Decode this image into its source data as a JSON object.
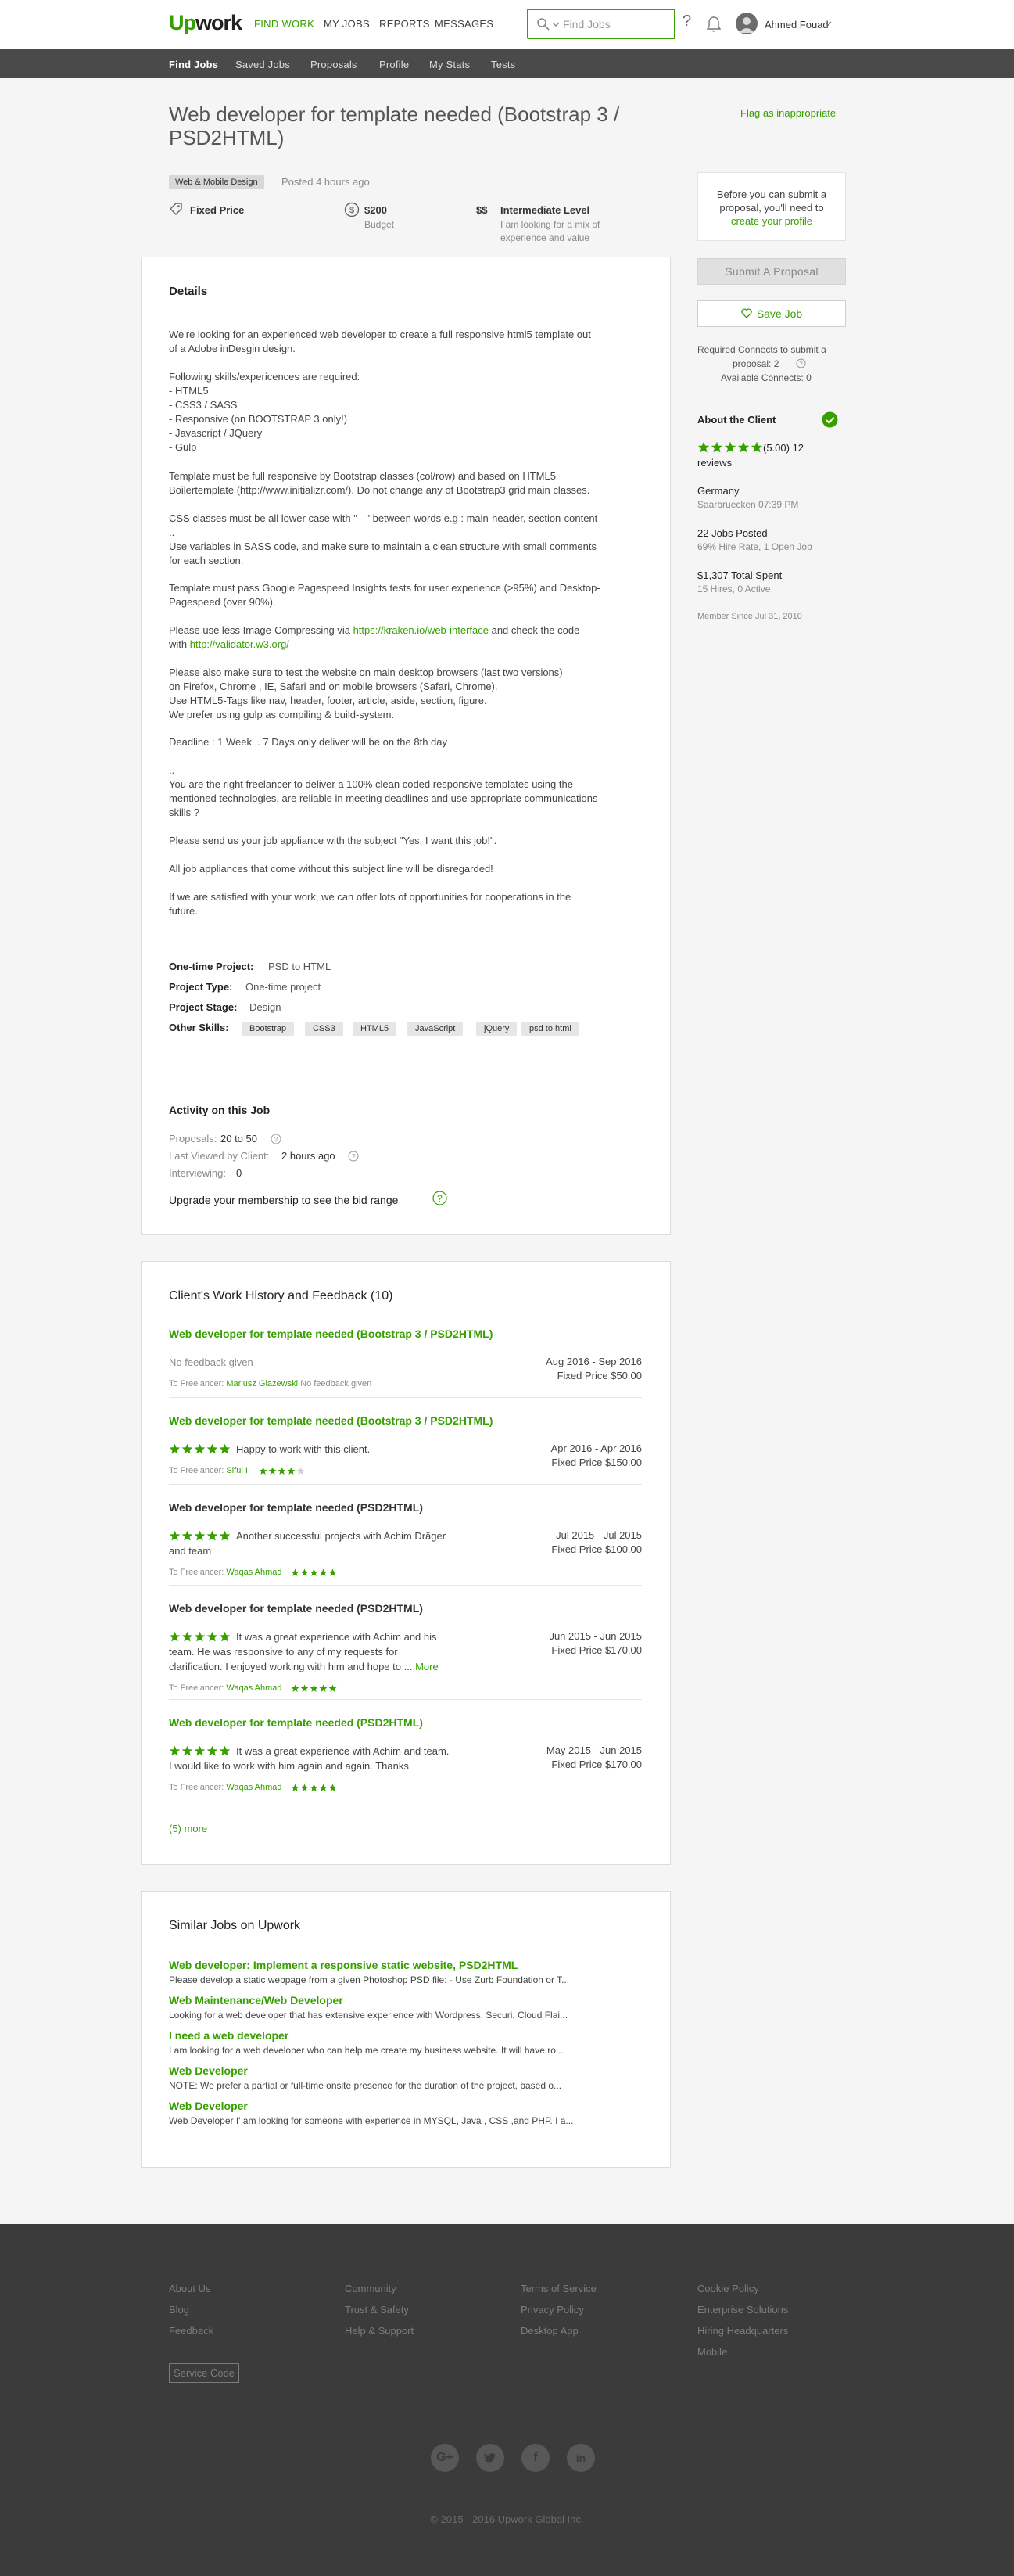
{
  "header": {
    "logo_up": "Up",
    "logo_work": "work",
    "nav": [
      "FIND WORK",
      "MY JOBS",
      "REPORTS",
      "MESSAGES"
    ],
    "search_placeholder": "Find Jobs",
    "help": "?",
    "user_name": "Ahmed Fouad"
  },
  "subnav": [
    "Find Jobs",
    "Saved Jobs",
    "Proposals",
    "Profile",
    "My Stats",
    "Tests"
  ],
  "job": {
    "title": "Web developer for template needed (Bootstrap 3 / PSD2HTML)",
    "flag": "Flag as inappropriate",
    "category": "Web & Mobile Design",
    "posted": "Posted 4 hours ago",
    "price_type": "Fixed Price",
    "budget_value": "$200",
    "budget_label": "Budget",
    "level_symbol": "$$",
    "level": "Intermediate Level",
    "level_desc": "I am looking for a mix of\nexperience and value"
  },
  "details": {
    "heading": "Details",
    "paragraphs": [
      "We're looking for an experienced web developer to create a full responsive html5 template out\nof a Adobe inDesgin design.",
      "Following skills/expericences are required:\n- HTML5\n- CSS3 / SASS\n- Responsive (on BOOTSTRAP 3 only!)\n- Javascript / JQuery\n- Gulp",
      "Template must be full responsive by Bootstrap classes (col/row) and based on HTML5\nBoilertemplate (http://www.initializr.com/). Do not change any of Bootstrap3 grid main classes.",
      "CSS classes must be all lower case with \" - \" between words e.g : main-header, section-content\n..\nUse variables in SASS code, and make sure to maintain a clean structure with small comments\nfor each section.",
      "Template must pass Google Pagespeed Insights tests for user experience (>95%) and Desktop-\nPagespeed (over 90%)."
    ],
    "compress_pre": "Please use less Image-Compressing via ",
    "compress_link": "https://kraken.io/web-interface",
    "compress_mid": " and check the code",
    "compress_with": "with ",
    "validator_link": "http://validator.w3.org/",
    "paragraphs2": [
      "Please also make sure to test the website on main desktop browsers (last two versions)\non Firefox, Chrome , IE, Safari and on mobile browsers (Safari, Chrome).\nUse HTML5-Tags like nav, header, footer, article, aside, section, figure.\nWe prefer using gulp as compiling & build-system.",
      "Deadline : 1 Week .. 7 Days only deliver will be on the 8th day",
      "..\nYou are the right freelancer to deliver a 100% clean coded responsive templates using the\nmentioned technologies, are reliable in meeting deadlines and use appropriate communications\nskills ?",
      "Please send us your job appliance with the subject \"Yes, I want this job!\".",
      "All job appliances that come without this subject line will be disregarded!",
      "If we are satisfied with your work, we can offer lots of opportunities for cooperations in the\nfuture."
    ],
    "onetime_label": "One-time Project:",
    "onetime_value": "PSD to HTML",
    "type_label": "Project Type:",
    "type_value": "One-time project",
    "stage_label": "Project Stage:",
    "stage_value": "Design",
    "skills_label": "Other Skills:",
    "skills": [
      "Bootstrap",
      "CSS3",
      "HTML5",
      "JavaScript",
      "jQuery",
      "psd to html"
    ]
  },
  "activity": {
    "heading": "Activity on this Job",
    "proposals_label": "Proposals:",
    "proposals_value": "20 to 50",
    "viewed_label": "Last Viewed by Client:",
    "viewed_value": "2 hours ago",
    "interviewing_label": "Interviewing:",
    "interviewing_value": "0",
    "upgrade": "Upgrade your membership to see the bid range"
  },
  "sidebar": {
    "notice_pre": "Before you can submit a proposal, you'll need to ",
    "notice_link": "create your profile",
    "submit": "Submit A Proposal",
    "save": "Save Job",
    "connects_required": "Required Connects to submit a",
    "connects_required2": "proposal: 2",
    "connects_available": "Available Connects: 0",
    "about": "About the Client",
    "rating": 5,
    "rating_text": "(5.00) 12",
    "reviews": "reviews",
    "country": "Germany",
    "city_time": "Saarbruecken 07:39 PM",
    "jobs_posted": "22 Jobs Posted",
    "hire_rate": "69% Hire Rate, 1 Open Job",
    "total_spent": "$1,307 Total Spent",
    "hires": "15 Hires, 0 Active",
    "member_since": "Member Since Jul 31, 2010"
  },
  "history": {
    "heading": "Client's Work History and Feedback (10)",
    "to_label": "To Freelancer:",
    "items": [
      {
        "title": "Web developer for template needed (Bootstrap 3 / PSD2HTML)",
        "linked": true,
        "client_stars": 0,
        "feedback": "No feedback given",
        "dates": "Aug 2016 - Sep 2016",
        "price": "Fixed Price $50.00",
        "freelancer": "Mariusz Glazewski",
        "fl_feedback": "No feedback given",
        "fl_stars": 0
      },
      {
        "title": "Web developer for template needed (Bootstrap 3 / PSD2HTML)",
        "linked": true,
        "client_stars": 5,
        "feedback": "Happy to work with this client.",
        "dates": "Apr 2016 - Apr 2016",
        "price": "Fixed Price $150.00",
        "freelancer": "Siful I.",
        "fl_feedback": "",
        "fl_stars": 4
      },
      {
        "title": "Web developer for template needed (PSD2HTML)",
        "linked": false,
        "client_stars": 5,
        "feedback": "Another successful projects with Achim Dräger\nand team",
        "dates": "Jul 2015 - Jul 2015",
        "price": "Fixed Price $100.00",
        "freelancer": "Waqas Ahmad",
        "fl_feedback": "",
        "fl_stars": 5
      },
      {
        "title": "Web developer for template needed (PSD2HTML)",
        "linked": false,
        "client_stars": 5,
        "feedback": "It was a great experience with Achim and his\nteam. He was responsive to any of my requests for\nclarification. I enjoyed working with him and hope to ...",
        "more": "More",
        "dates": "Jun 2015 - Jun 2015",
        "price": "Fixed Price $170.00",
        "freelancer": "Waqas Ahmad",
        "fl_feedback": "",
        "fl_stars": 5
      },
      {
        "title": "Web developer for template needed (PSD2HTML)",
        "linked": true,
        "client_stars": 5,
        "feedback": "It was a great experience with Achim and team.\nI would like to work with him again and again.  Thanks",
        "dates": "May 2015 - Jun 2015",
        "price": "Fixed Price $170.00",
        "freelancer": "Waqas Ahmad",
        "fl_feedback": "",
        "fl_stars": 5
      }
    ],
    "more": "(5) more"
  },
  "similar": {
    "heading": "Similar Jobs on Upwork",
    "items": [
      {
        "title": "Web developer: Implement a responsive static website, PSD2HTML",
        "desc": "Please develop a static webpage from a given Photoshop PSD file: - Use Zurb Foundation or T..."
      },
      {
        "title": "Web Maintenance/Web Developer",
        "desc": "Looking for a web developer that has extensive experience with Wordpress, Securi, Cloud Flai..."
      },
      {
        "title": "I need a web developer",
        "desc": "I am looking for a web developer who can help me create my business website. It will have ro..."
      },
      {
        "title": "Web Developer",
        "desc": "NOTE: We prefer a partial or full-time onsite presence for the duration of the project, based o..."
      },
      {
        "title": "Web Developer",
        "desc": "Web Developer I' am looking for someone with experience in MYSQL, Java , CSS ,and PHP. I a..."
      }
    ]
  },
  "footer": {
    "col1": [
      "About Us",
      "Blog",
      "Feedback"
    ],
    "col2": [
      "Community",
      "Trust & Safety",
      "Help & Support"
    ],
    "col3": [
      "Terms of Service",
      "Privacy Policy",
      "Desktop App"
    ],
    "col4": [
      "Cookie Policy",
      "Enterprise Solutions",
      "Hiring Headquarters",
      "Mobile"
    ],
    "service_code": "Service Code",
    "social": [
      "G+",
      "twitter",
      "facebook",
      "in"
    ],
    "copyright": "© 2015 - 2016 Upwork Global Inc."
  },
  "colors": {
    "accent": "#37a000",
    "subnav": "#4a4a4a",
    "footer": "#3b3b3b"
  }
}
